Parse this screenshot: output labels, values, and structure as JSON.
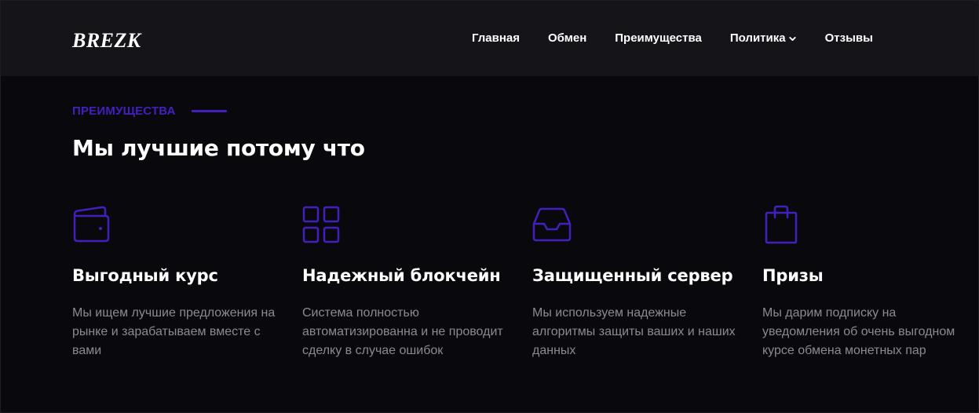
{
  "header": {
    "logo": "BREZK",
    "nav": [
      {
        "label": "Главная"
      },
      {
        "label": "Обмен"
      },
      {
        "label": "Преимущества"
      },
      {
        "label": "Политика",
        "has_dropdown": true
      },
      {
        "label": "Отзывы"
      }
    ]
  },
  "section": {
    "eyebrow": "ПРЕИМУЩЕСТВА",
    "heading": "Мы лучшие потому что",
    "features": [
      {
        "icon": "wallet-icon",
        "title": "Выгодный курс",
        "description": "Мы ищем лучшие предложения на рынке и зарабатываем вместе с вами"
      },
      {
        "icon": "grid-icon",
        "title": "Надежный блокчейн",
        "description": "Система полностью автоматизированна и не проводит сделку в случае ошибок"
      },
      {
        "icon": "inbox-icon",
        "title": "Защищенный сервер",
        "description": "Мы используем надежные алгоритмы защиты ваших и наших данных"
      },
      {
        "icon": "shopping-bag-icon",
        "title": "Призы",
        "description": "Мы дарим подписку на уведомления об очень выгодном курсе обмена монетных пар"
      }
    ]
  },
  "colors": {
    "background": "#09090d",
    "header_background": "#141419",
    "accent": "#4320bd",
    "text_primary": "#ffffff",
    "text_muted": "#8a8a94"
  }
}
